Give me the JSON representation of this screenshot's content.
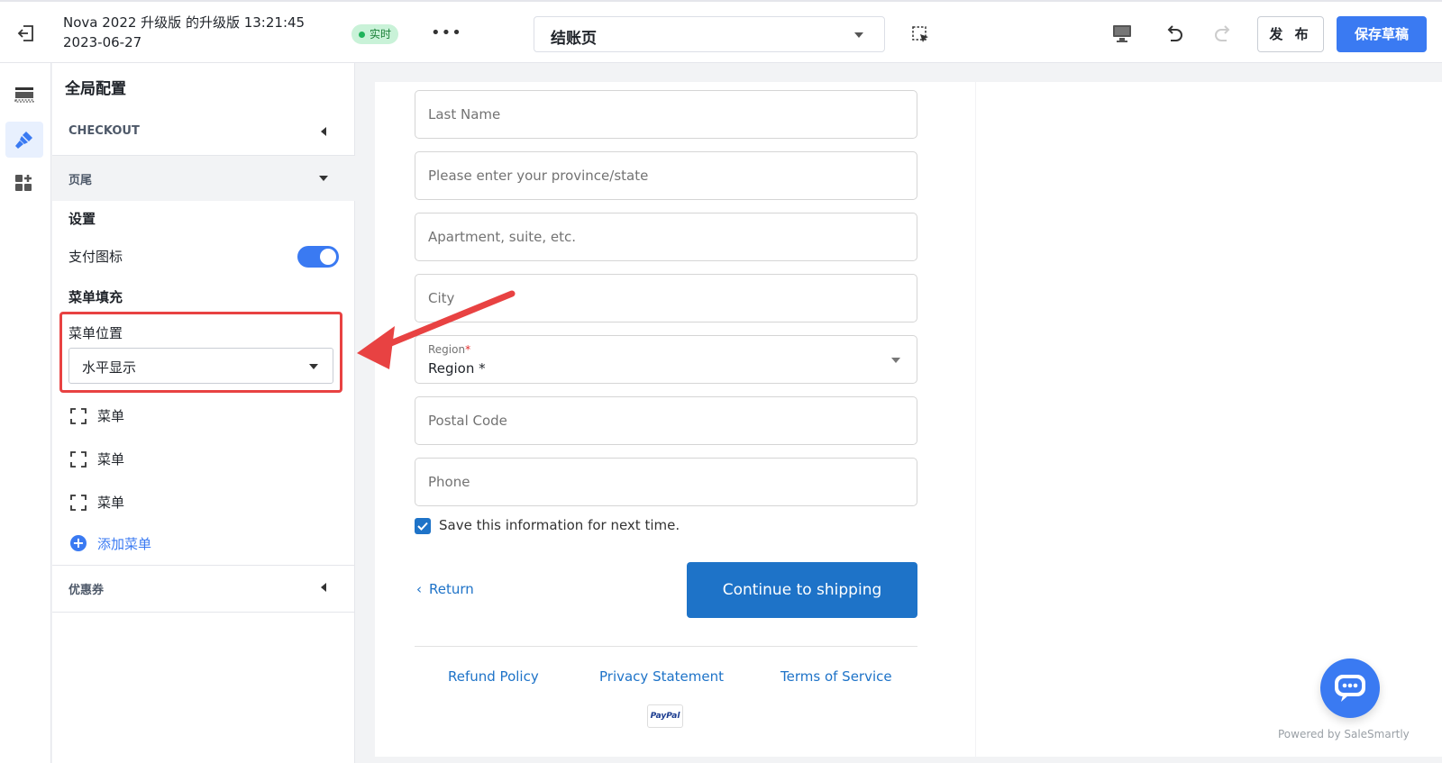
{
  "header": {
    "title_line1": "Nova 2022 升级版 的升级版 13:21:45",
    "title_line2": "2023-06-27",
    "status": "实时",
    "more": "•••",
    "page_select": "结账页",
    "publish_label": "发 布",
    "save_label": "保存草稿",
    "accent_color": "#3a7af2"
  },
  "rail": {
    "items": [
      {
        "icon": "section-layout-icon",
        "active": false
      },
      {
        "icon": "brush-icon",
        "active": true
      },
      {
        "icon": "apps-add-icon",
        "active": false
      }
    ]
  },
  "panel": {
    "title": "全局配置",
    "sections": [
      {
        "label": "CHECKOUT",
        "expanded": false
      },
      {
        "label": "页尾",
        "expanded": true
      },
      {
        "label": "优惠券",
        "expanded": false
      }
    ],
    "settings_heading": "设置",
    "payment_icons_label": "支付图标",
    "payment_icons_enabled": true,
    "menu_fill_heading": "菜单填充",
    "menu_position_label": "菜单位置",
    "menu_position_value": "水平显示",
    "menu_items": [
      "菜单",
      "菜单",
      "菜单"
    ],
    "add_menu_label": "添加菜单"
  },
  "checkout_form": {
    "fields": [
      {
        "placeholder": "Last Name"
      },
      {
        "placeholder": "Please enter your province/state"
      },
      {
        "placeholder": "Apartment, suite, etc."
      },
      {
        "placeholder": "City"
      },
      {
        "label": "Region",
        "required_mark": "*",
        "value": "Region *"
      },
      {
        "placeholder": "Postal Code"
      },
      {
        "placeholder": "Phone"
      }
    ],
    "save_info_label": "Save this information for next time.",
    "save_info_checked": true,
    "return_label": "Return",
    "continue_label": "Continue to shipping",
    "footer_links": [
      "Refund Policy",
      "Privacy Statement",
      "Terms of Service"
    ],
    "payment_badge": "PayPal",
    "link_color": "#1e73c8"
  },
  "widget": {
    "powered_by": "Powered by SaleSmartly"
  }
}
